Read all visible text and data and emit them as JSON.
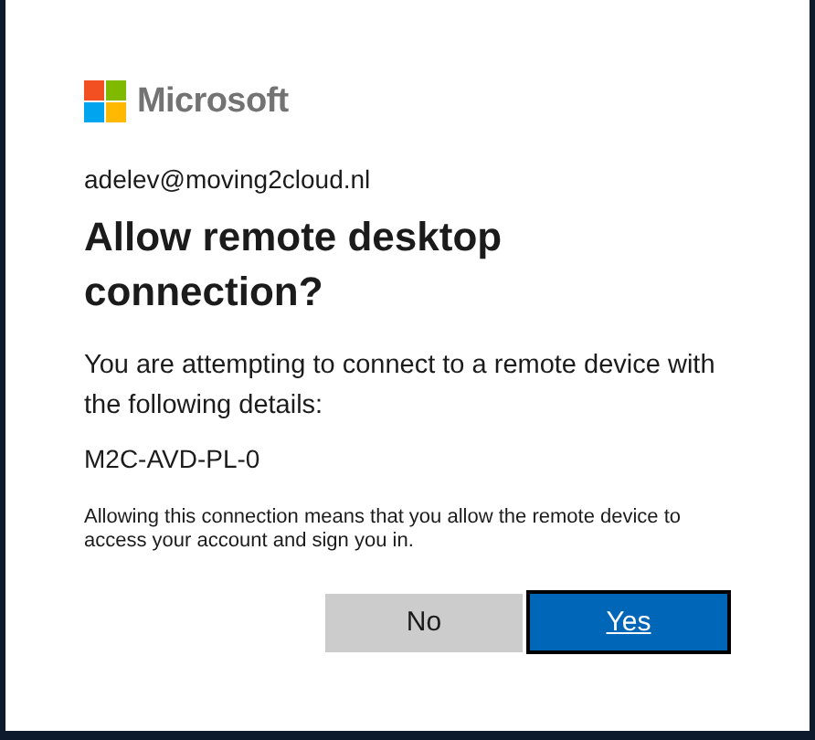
{
  "logo": {
    "text": "Microsoft"
  },
  "account": "adelev@moving2cloud.nl",
  "title": "Allow remote desktop connection?",
  "description": "You are attempting to connect to a remote device with the following details:",
  "device": "M2C-AVD-PL-0",
  "notice": "Allowing this connection means that you allow the remote device to access your account and sign you in.",
  "buttons": [
    {
      "label": "No",
      "kind": "secondary",
      "focused": false
    },
    {
      "label": "Yes",
      "kind": "primary",
      "focused": true
    }
  ]
}
